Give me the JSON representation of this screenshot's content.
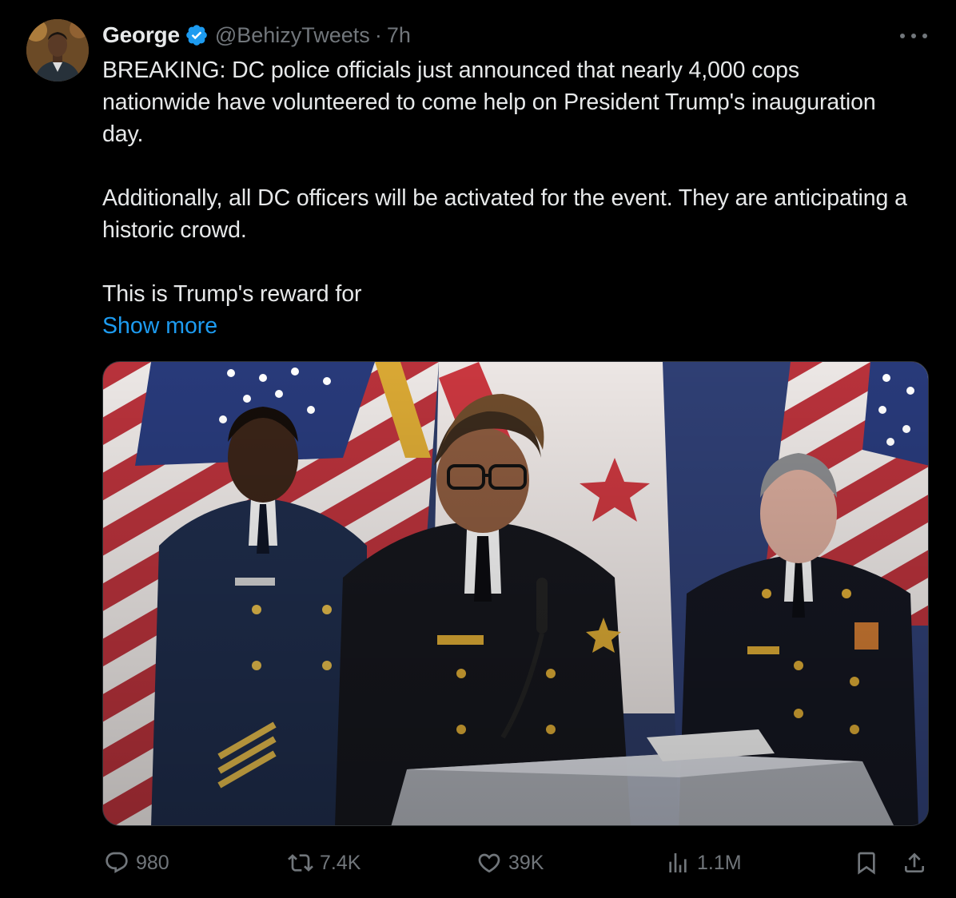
{
  "tweet": {
    "author_name": "George",
    "handle": "@BehizyTweets",
    "separator": "·",
    "time": "7h",
    "paragraphs": [
      "BREAKING: DC police officials just announced that nearly 4,000 cops nationwide have volunteered to come help on President Trump's inauguration day.",
      "Additionally, all DC officers will be activated for the event. They are anticipating a historic crowd.",
      "This is Trump's reward for"
    ],
    "show_more": "Show more",
    "verified_icon": "verified-badge-icon",
    "more_icon": "more-horizontal-icon"
  },
  "actions": {
    "replies": "980",
    "reposts": "7.4K",
    "likes": "39K",
    "views": "1.1M"
  },
  "colors": {
    "background": "#000000",
    "text": "#e7e9ea",
    "muted": "#71767b",
    "accent": "#1d9bf0"
  }
}
